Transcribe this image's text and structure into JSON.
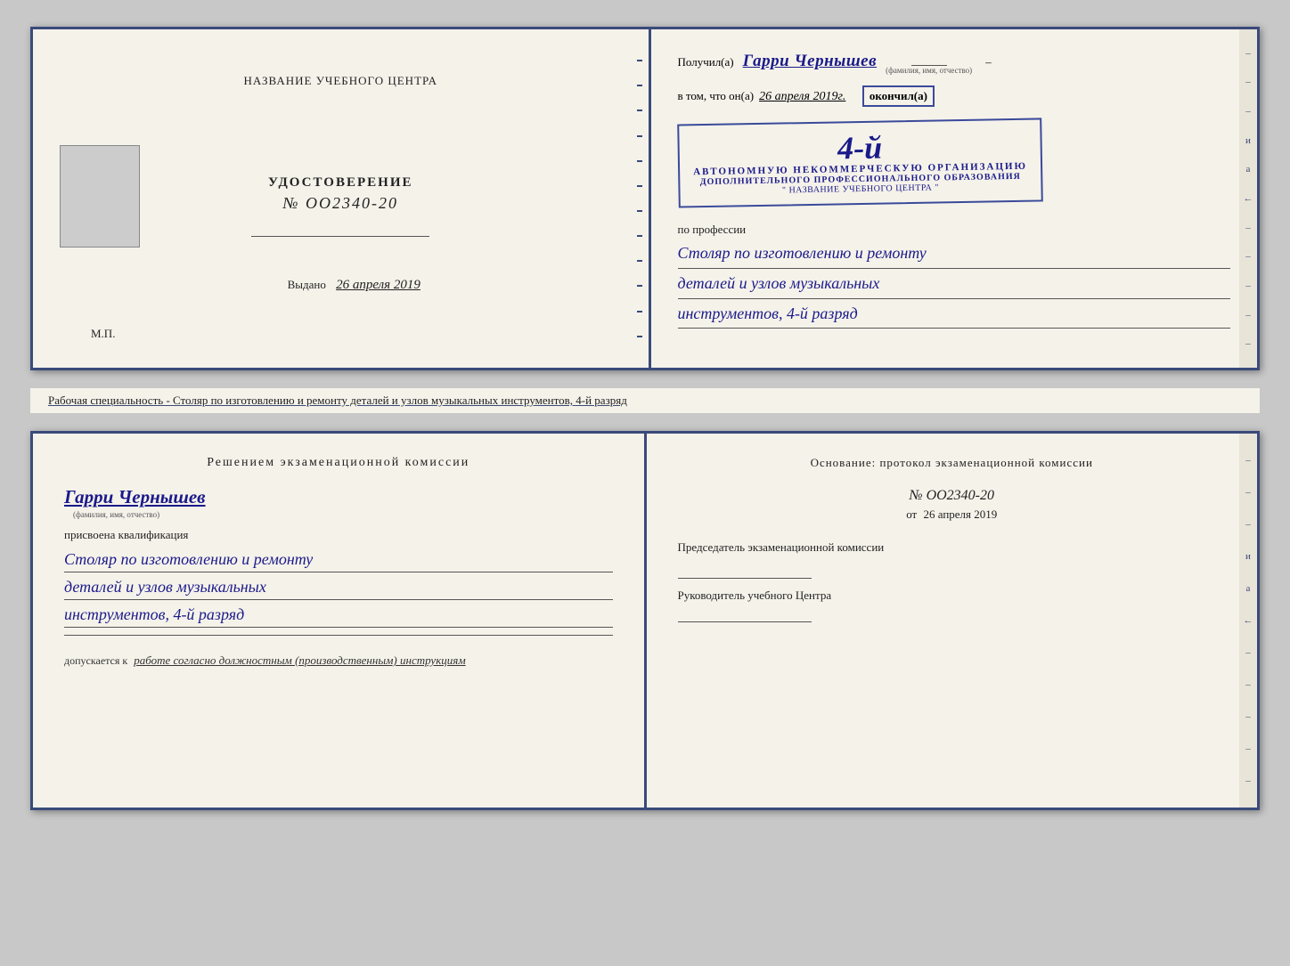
{
  "page": {
    "background": "#c8c8c8"
  },
  "doc1": {
    "left": {
      "title": "НАЗВАНИЕ УЧЕБНОГО ЦЕНТРА",
      "cert_label": "УДОСТОВЕРЕНИЕ",
      "cert_number": "№ OO2340-20",
      "issued_label": "Выдано",
      "issued_date": "26 апреля 2019",
      "mp_label": "М.П."
    },
    "right": {
      "recipient_prefix": "Получил(а)",
      "recipient_name": "Гарри Чернышев",
      "recipient_sublabel": "(фамилия, имя, отчество)",
      "dash1": "–",
      "date_prefix": "в том, что он(а)",
      "date_value": "26 апреля 2019г.",
      "finished_label": "окончил(а)",
      "stamp_grade": "4-й",
      "stamp_line1": "АВТОНОМНУЮ НЕКОММЕРЧЕСКУЮ ОРГАНИЗАЦИЮ",
      "stamp_line2": "ДОПОЛНИТЕЛЬНОГО ПРОФЕССИОНАЛЬНОГО ОБРАЗОВАНИЯ",
      "stamp_line3": "\" НАЗВАНИЕ УЧЕБНОГО ЦЕНТРА \"",
      "profession_label": "по профессии",
      "profession_line1": "Столяр по изготовлению и ремонту",
      "profession_line2": "деталей и узлов музыкальных",
      "profession_line3": "инструментов, 4-й разряд"
    }
  },
  "caption": {
    "text": "Рабочая специальность - Столяр по изготовлению и ремонту деталей и узлов музыкальных инструментов, 4-й разряд"
  },
  "doc2": {
    "left": {
      "decision_title": "Решением  экзаменационной  комиссии",
      "person_name": "Гарри Чернышев",
      "person_sublabel": "(фамилия, имя, отчество)",
      "assigned_label": "присвоена квалификация",
      "qual_line1": "Столяр по изготовлению и ремонту",
      "qual_line2": "деталей и узлов музыкальных",
      "qual_line3": "инструментов, 4-й разряд",
      "allowed_prefix": "допускается к",
      "allowed_text": "работе согласно должностным (производственным) инструкциям"
    },
    "right": {
      "basis_title": "Основание: протокол экзаменационной  комиссии",
      "protocol_number": "№  OO2340-20",
      "protocol_date_prefix": "от",
      "protocol_date": "26 апреля 2019",
      "chairman_label": "Председатель экзаменационной комиссии",
      "director_label": "Руководитель учебного Центра",
      "dash_items": [
        "–",
        "–",
        "–",
        "и",
        "а",
        "←",
        "–",
        "–",
        "–",
        "–",
        "–"
      ]
    }
  }
}
